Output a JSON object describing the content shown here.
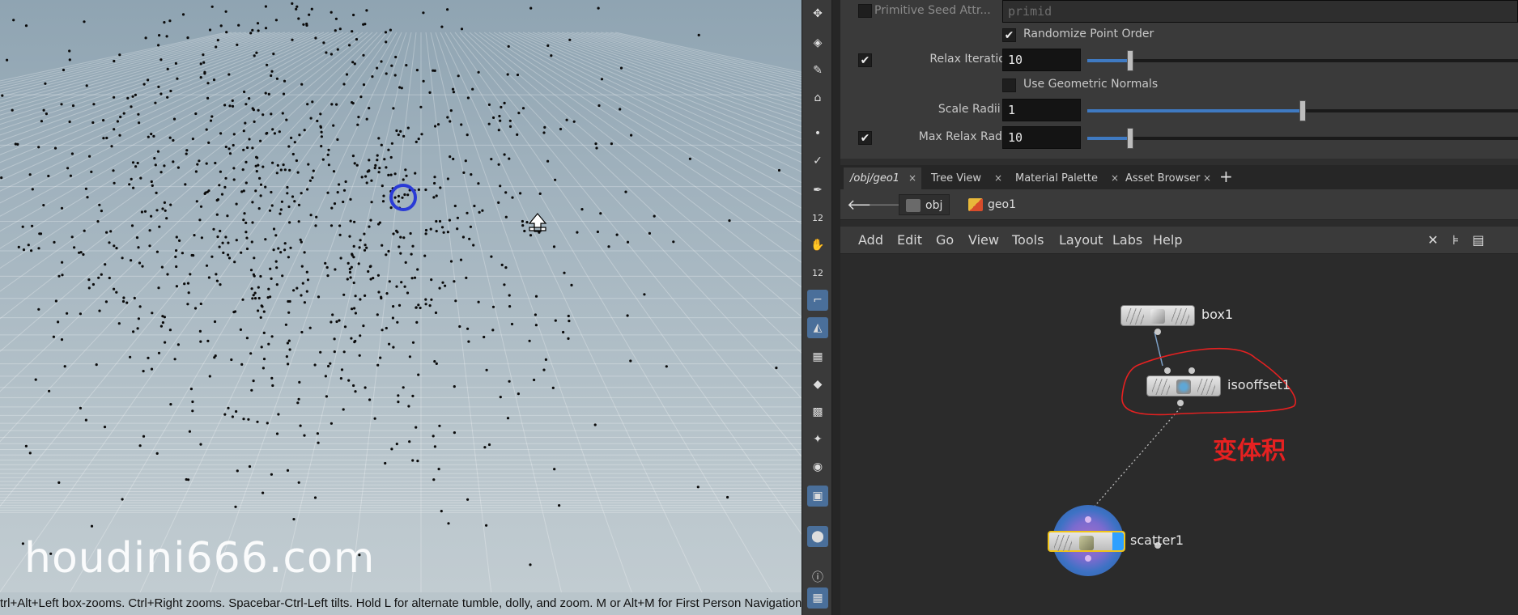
{
  "viewport": {
    "watermark": "houdini666.com",
    "status_text": "trl+Alt+Left box-zooms. Ctrl+Right zooms. Spacebar-Ctrl-Left tilts. Hold L for alternate tumble, dolly, and zoom. M or Alt+M for First Person Navigation.",
    "point_count": 1100
  },
  "shelf": {
    "icons": [
      "select-icon",
      "view-icon",
      "pose-icon",
      "camera-icon",
      "point-icon",
      "brush-icon",
      "pen-icon",
      "number-icon",
      "hand-icon",
      "number-icon",
      "angle-icon",
      "plane-icon",
      "grid-icon",
      "diamond-icon",
      "landscape-icon",
      "light-icon",
      "circle-icon",
      "image-icon",
      "pin-icon",
      "info-icon",
      "layout-icon",
      "eye-icon"
    ],
    "badge": "12"
  },
  "params": {
    "primitive_seed_label": "Primitive Seed Attr...",
    "primitive_seed_value": "primid",
    "randomize_label": "Randomize Point Order",
    "relax_iterations_label": "Relax Iterations",
    "relax_iterations_value": "10",
    "relax_iterations_fraction": 0.1,
    "use_geometric_normals_label": "Use Geometric Normals",
    "scale_radii_label": "Scale Radii By",
    "scale_radii_value": "1",
    "scale_radii_fraction": 0.5,
    "max_relax_radius_label": "Max Relax Radius",
    "max_relax_radius_value": "10",
    "max_relax_radius_fraction": 0.1
  },
  "tabs": [
    {
      "label": "/obj/geo1",
      "active": true
    },
    {
      "label": "Tree View",
      "active": false
    },
    {
      "label": "Material Palette",
      "active": false
    },
    {
      "label": "Asset Browser",
      "active": false
    }
  ],
  "path": {
    "crumb1": "obj",
    "crumb2": "geo1"
  },
  "menu": [
    "Add",
    "Edit",
    "Go",
    "View",
    "Tools",
    "Layout",
    "Labs",
    "Help"
  ],
  "nodes": {
    "box": "box1",
    "isooffset": "isooffset1",
    "scatter": "scatter1"
  },
  "annotation": "变体积",
  "colors": {
    "accent": "#3f7ac2",
    "annotation": "#e52121",
    "selected_node": "#f0c419",
    "display_flag": "#2ea0ff"
  }
}
